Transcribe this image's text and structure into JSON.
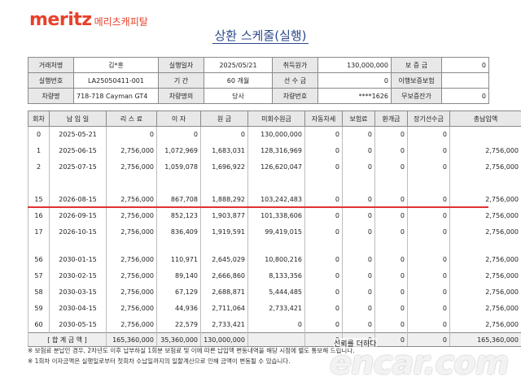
{
  "logo": {
    "brand": "meritz",
    "sub": "메리츠캐피탈"
  },
  "title": "상환 스케줄(실행)",
  "info": {
    "row1": [
      "거래처명",
      "김*훈",
      "실행일자",
      "2025/05/21",
      "취득원가",
      "130,000,000",
      "보 증 금",
      "0"
    ],
    "row2": [
      "실행번호",
      "LA25050411-001",
      "기 간",
      "60 개월",
      "선 수 금",
      "0",
      "이행보증보험",
      ""
    ],
    "row3": [
      "차량명",
      "718-718 Cayman GT4",
      "차량명의",
      "당사",
      "차량번호",
      "****1626",
      "무보증잔가",
      "0"
    ]
  },
  "schedule": {
    "headers": [
      "회차",
      "납 입 일",
      "리 스 료",
      "이 자",
      "원 금",
      "미회수원금",
      "자동차세",
      "보험료",
      "환개금",
      "장기선수금",
      "총납입액"
    ],
    "group1": [
      [
        "0",
        "2025-05-21",
        "0",
        "0",
        "0",
        "130,000,000",
        "0",
        "0",
        "0",
        "0",
        ""
      ],
      [
        "1",
        "2025-06-15",
        "2,756,000",
        "1,072,969",
        "1,683,031",
        "128,316,969",
        "0",
        "0",
        "0",
        "0",
        "2,756,000"
      ],
      [
        "2",
        "2025-07-15",
        "2,756,000",
        "1,059,078",
        "1,696,922",
        "126,620,047",
        "0",
        "0",
        "0",
        "0",
        "2,756,000"
      ]
    ],
    "group2": [
      [
        "15",
        "2026-08-15",
        "2,756,000",
        "867,708",
        "1,888,292",
        "103,242,483",
        "0",
        "0",
        "0",
        "0",
        "2,756,000"
      ],
      [
        "16",
        "2026-09-15",
        "2,756,000",
        "852,123",
        "1,903,877",
        "101,338,606",
        "0",
        "0",
        "0",
        "0",
        "2,756,000"
      ],
      [
        "17",
        "2026-10-15",
        "2,756,000",
        "836,409",
        "1,919,591",
        "99,419,015",
        "0",
        "0",
        "0",
        "0",
        "2,756,000"
      ]
    ],
    "group3": [
      [
        "56",
        "2030-01-15",
        "2,756,000",
        "110,971",
        "2,645,029",
        "10,800,216",
        "0",
        "0",
        "0",
        "0",
        "2,756,000"
      ],
      [
        "57",
        "2030-02-15",
        "2,756,000",
        "89,140",
        "2,666,860",
        "8,133,356",
        "0",
        "0",
        "0",
        "0",
        "2,756,000"
      ],
      [
        "58",
        "2030-03-15",
        "2,756,000",
        "67,129",
        "2,688,871",
        "5,444,485",
        "0",
        "0",
        "0",
        "0",
        "2,756,000"
      ],
      [
        "59",
        "2030-04-15",
        "2,756,000",
        "44,936",
        "2,711,064",
        "2,733,421",
        "0",
        "0",
        "0",
        "0",
        "2,756,000"
      ],
      [
        "60",
        "2030-05-15",
        "2,756,000",
        "22,579",
        "2,733,421",
        "0",
        "0",
        "0",
        "0",
        "0",
        "2,756,000"
      ]
    ],
    "total": [
      "[ 합 계 금 액 ]",
      "165,360,000",
      "35,360,000",
      "130,000,000",
      "",
      "0",
      "0",
      "0",
      "0",
      "165,360,000"
    ]
  },
  "notes": [
    "※ 보험료 분납인 경우, 2차년도 이후 납부하실 1회분 보험료 및 이에 따른 납입액 변동내역을 해당 시점에 별도 통보해 드립니다.",
    "※ 1회차 이자금액은 실행일로부터 첫회차 수납일까지의 일할계산으로 인해 금액이 변동될 수 있습니다."
  ],
  "watermark": {
    "text": "신뢰를 더하다",
    "logo": "encar.com"
  }
}
